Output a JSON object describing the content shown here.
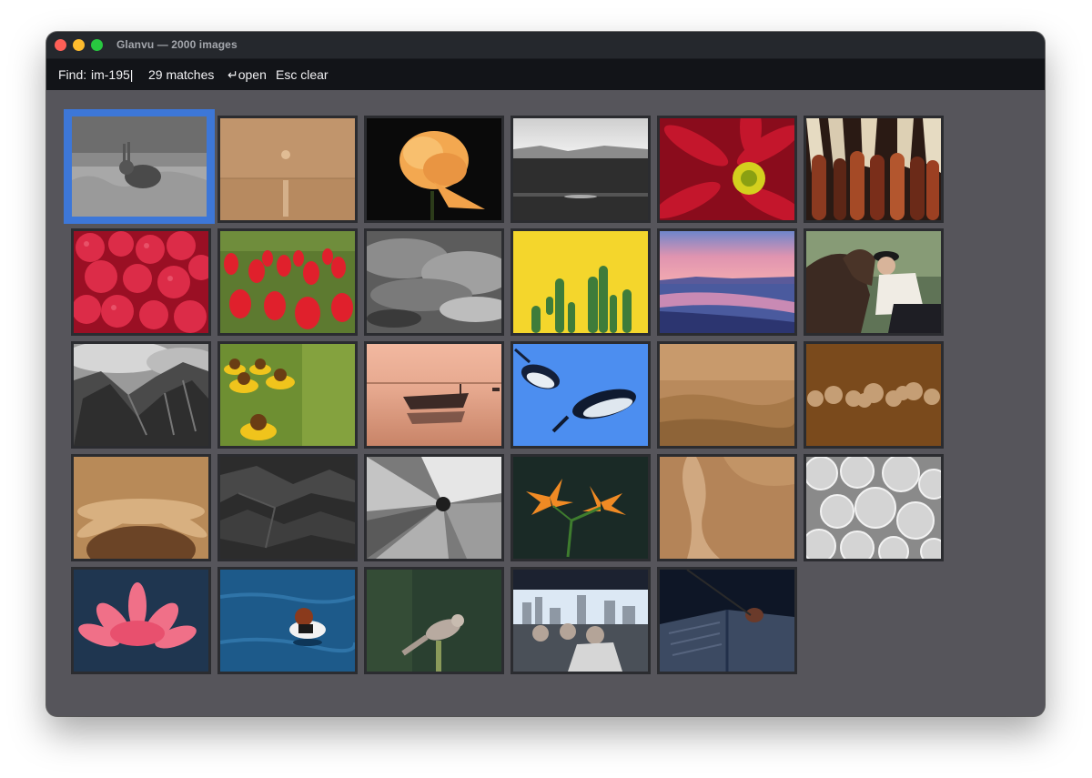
{
  "window": {
    "title": "Glanvu — 2000 images"
  },
  "findbar": {
    "label": "Find:",
    "query": "im-195|",
    "matches": "29 matches",
    "open_hint": "↵open",
    "clear_hint": "Esc clear"
  },
  "colors": {
    "selection": "#3d77d8",
    "background": "#56555b",
    "findbar": "#121418",
    "titlebar": "#25282d"
  },
  "grid": {
    "columns": 6,
    "selected_index": 0,
    "thumbnails": [
      {
        "subject": "rabbit in grass (grayscale)"
      },
      {
        "subject": "sepia sun over sea"
      },
      {
        "subject": "orange rose on black"
      },
      {
        "subject": "grayscale misty lake"
      },
      {
        "subject": "red daisy with yellow center"
      },
      {
        "subject": "ornamental corn cobs"
      },
      {
        "subject": "raspberries"
      },
      {
        "subject": "red tulip field"
      },
      {
        "subject": "grayscale cloudy sky"
      },
      {
        "subject": "cacti on yellow"
      },
      {
        "subject": "purple sunset beach"
      },
      {
        "subject": "person with horse"
      },
      {
        "subject": "grayscale rocky mountains"
      },
      {
        "subject": "yellow coneflowers"
      },
      {
        "subject": "rowboat at sunset"
      },
      {
        "subject": "penguins swimming on blue"
      },
      {
        "subject": "sepia foggy landscape"
      },
      {
        "subject": "brown bokeh lights"
      },
      {
        "subject": "sepia sunflower"
      },
      {
        "subject": "grayscale crumpled texture"
      },
      {
        "subject": "grayscale flower macro"
      },
      {
        "subject": "orange lilies"
      },
      {
        "subject": "sepia aerial coastline"
      },
      {
        "subject": "grayscale citrus slices"
      },
      {
        "subject": "pink lotus"
      },
      {
        "subject": "duck on blue water"
      },
      {
        "subject": "small bird on branch"
      },
      {
        "subject": "crowd facing city skyline"
      },
      {
        "subject": "open book with rose"
      }
    ]
  }
}
